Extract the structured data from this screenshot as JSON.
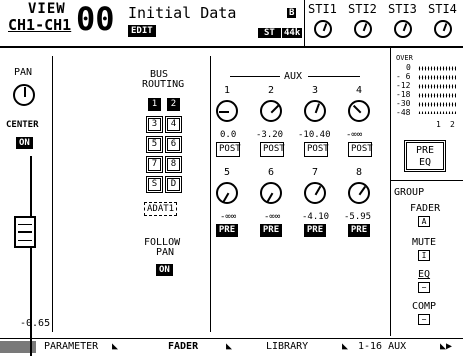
{
  "header": {
    "view_title": "VIEW",
    "channel_range": "CH1-CH1",
    "scene_number": "00",
    "scene_name": "Initial Data",
    "edit_label": "EDIT",
    "b_label": "B",
    "st_label": "ST",
    "rate_label": "44k",
    "st_inputs": [
      "STI1",
      "STI2",
      "STI3",
      "STI4"
    ]
  },
  "pan": {
    "label": "PAN",
    "value": "CENTER",
    "on_label": "ON",
    "fader_value": "-0.65"
  },
  "bus_routing": {
    "title_1": "BUS",
    "title_2": "ROUTING",
    "buttons": [
      {
        "label": "1",
        "active": true
      },
      {
        "label": "2",
        "active": true
      },
      {
        "label": "3",
        "active": false
      },
      {
        "label": "4",
        "active": false
      },
      {
        "label": "5",
        "active": false
      },
      {
        "label": "6",
        "active": false
      },
      {
        "label": "7",
        "active": false
      },
      {
        "label": "8",
        "active": false
      },
      {
        "label": "S",
        "active": false
      },
      {
        "label": "D",
        "active": false
      }
    ],
    "adat_label": "ADAT1",
    "follow_pan_1": "FOLLOW",
    "follow_pan_2": "PAN",
    "follow_on": "ON"
  },
  "aux": {
    "title": "AUX",
    "channels": [
      {
        "number": "1",
        "value": "0.0",
        "mode": "POST"
      },
      {
        "number": "2",
        "value": "-3.20",
        "mode": "POST"
      },
      {
        "number": "3",
        "value": "-10.40",
        "mode": "POST"
      },
      {
        "number": "4",
        "value": "-∞∞",
        "mode": "POST"
      },
      {
        "number": "5",
        "value": "-∞∞",
        "mode": "PRE"
      },
      {
        "number": "6",
        "value": "-∞∞",
        "mode": "PRE"
      },
      {
        "number": "7",
        "value": "-4.10",
        "mode": "PRE"
      },
      {
        "number": "8",
        "value": "-5.95",
        "mode": "PRE"
      }
    ]
  },
  "meter": {
    "over": "OVER",
    "scale": [
      "0",
      "- 6",
      "-12",
      "-18",
      "-30",
      "-48"
    ],
    "channels": [
      "1",
      "2"
    ]
  },
  "pre_eq": {
    "line1": "PRE",
    "line2": "EQ"
  },
  "group": {
    "title": "GROUP",
    "fader": "FADER",
    "fader_val": "A",
    "mute": "MUTE",
    "mute_val": "I",
    "eq": "EQ",
    "eq_val": "−",
    "comp": "COMP",
    "comp_val": "−"
  },
  "tabs": [
    "PARAMETER",
    "FADER",
    "LIBRARY",
    "1-16 AUX"
  ]
}
